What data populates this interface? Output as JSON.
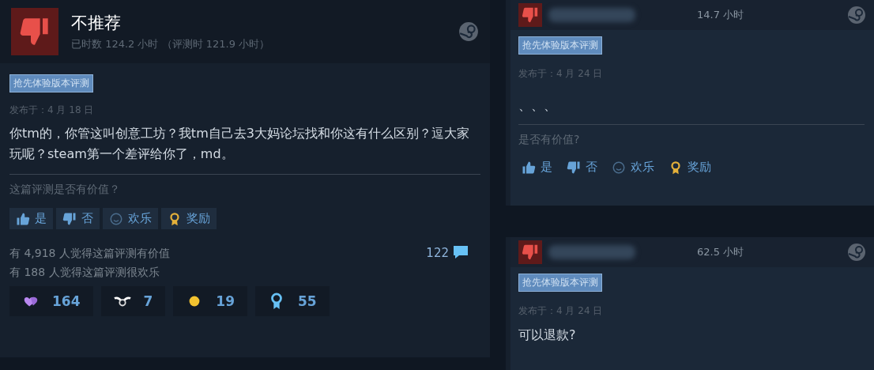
{
  "main_review": {
    "recommended": false,
    "verdict": "不推荐",
    "hours": "已时数 124.2 小时 （评测时 121.9 小时）",
    "tag": "抢先体验版本评测",
    "posted": "发布于：4 月 18 日",
    "body": "你tm的，你管这叫创意工坊？我tm自己去3大妈论坛找和你这有什么区别？逗大家玩呢？steam第一个差评给你了，md。",
    "question": "这篇评测是否有价值？",
    "votes": [
      {
        "kind": "yes",
        "label": "是"
      },
      {
        "kind": "no",
        "label": "否"
      },
      {
        "kind": "funny",
        "label": "欢乐"
      },
      {
        "kind": "award",
        "label": "奖励"
      }
    ],
    "stats": [
      "有 4,918 人觉得这篇评测有价值",
      "有 188 人觉得这篇评测很欢乐"
    ],
    "comments": "122",
    "awards": [
      {
        "kind": "hearts",
        "count": "164"
      },
      {
        "kind": "wings",
        "count": "7"
      },
      {
        "kind": "sun",
        "count": "19"
      },
      {
        "kind": "ribbon",
        "count": "55"
      }
    ]
  },
  "side_reviews": [
    {
      "recommended": false,
      "hours": "14.7 小时",
      "tag": "抢先体验版本评测",
      "posted": "发布于：4 月 24 日",
      "body": "、、、",
      "question": "是否有价值?",
      "votes": [
        {
          "kind": "yes",
          "label": "是"
        },
        {
          "kind": "no",
          "label": "否"
        },
        {
          "kind": "funny",
          "label": "欢乐"
        },
        {
          "kind": "award",
          "label": "奖励"
        }
      ]
    },
    {
      "recommended": false,
      "hours": "62.5 小时",
      "tag": "抢先体验版本评测",
      "posted": "发布于：4 月 24 日",
      "body": "可以退款?"
    }
  ]
}
